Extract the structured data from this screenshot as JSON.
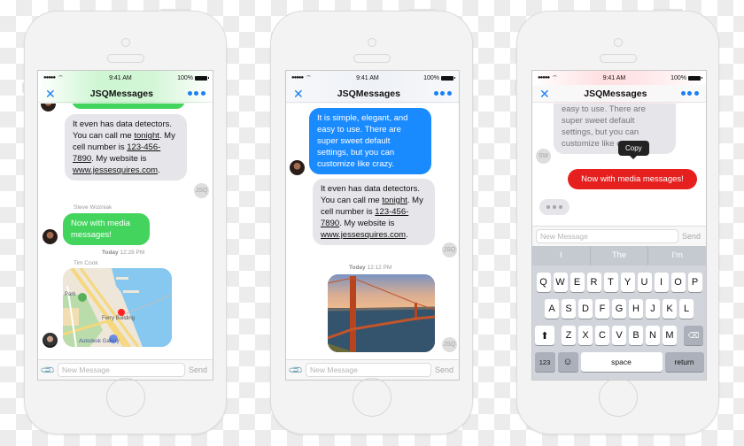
{
  "common": {
    "status_time": "9:41 AM",
    "battery": "100%",
    "title": "JSQMessages",
    "input_placeholder": "New Message",
    "send_label": "Send"
  },
  "colors": {
    "ios_blue": "#1a8aff",
    "green_bubble": "#43d45d",
    "red_bubble": "#e61f1f",
    "gray_bubble": "#e5e5ea"
  },
  "phone1": {
    "messages": [
      {
        "type": "incoming",
        "text_parts": [
          "It even has data detectors. You can call me ",
          "tonight",
          ". My cell number is ",
          "123-456-7890",
          ". My website is ",
          "www.jessesquires.com",
          "."
        ],
        "avatar": "JSQ"
      },
      {
        "sender": "Steve Wozniak",
        "type": "outgoing-green",
        "text": "Now with media messages!"
      },
      {
        "timestamp_day": "Today",
        "timestamp_time": "12:28 PM"
      },
      {
        "sender": "Tim Cook",
        "type": "map",
        "labels": [
          "Ferry Building",
          "Autodesk Gallery",
          "Park"
        ]
      }
    ]
  },
  "phone2": {
    "messages": [
      {
        "type": "outgoing-blue",
        "text": "It is simple, elegant, and easy to use. There are super sweet default settings, but you can customize like crazy."
      },
      {
        "type": "incoming",
        "text_parts": [
          "It even has data detectors. You can call me ",
          "tonight",
          ". My cell number is ",
          "123-456-7890",
          ". My website is ",
          "www.jessesquires.com",
          "."
        ],
        "avatar": "JSQ"
      },
      {
        "timestamp_day": "Today",
        "timestamp_time": "12:12 PM"
      },
      {
        "type": "photo",
        "description": "Golden Gate Bridge",
        "avatar": "JSQ"
      }
    ]
  },
  "phone3": {
    "messages": [
      {
        "type": "incoming-faded",
        "text": "It is simple, elegant, and easy to use. There are super sweet default settings, but you can customize like crazy.",
        "avatar": "SW"
      },
      {
        "type": "outgoing-red",
        "text": "Now with media messages!"
      },
      {
        "type": "typing-indicator"
      }
    ],
    "tooltip": "Copy",
    "keyboard": {
      "suggestions": [
        "I",
        "The",
        "I'm"
      ],
      "row1": [
        "Q",
        "W",
        "E",
        "R",
        "T",
        "Y",
        "U",
        "I",
        "O",
        "P"
      ],
      "row2": [
        "A",
        "S",
        "D",
        "F",
        "G",
        "H",
        "J",
        "K",
        "L"
      ],
      "row3": [
        "Z",
        "X",
        "C",
        "V",
        "B",
        "N",
        "M"
      ],
      "num_key": "123",
      "space_key": "space",
      "return_key": "return"
    }
  }
}
